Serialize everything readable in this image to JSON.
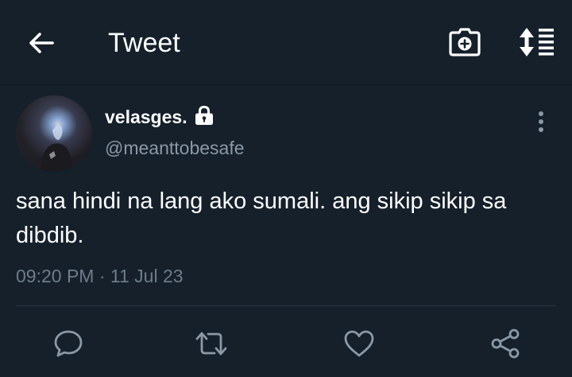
{
  "header": {
    "title": "Tweet",
    "icons": {
      "back": "back-arrow-icon",
      "camera": "camera-icon",
      "sort": "sort-icon"
    }
  },
  "tweet": {
    "display_name": "velasges.",
    "handle": "@meanttobesafe",
    "protected_icon": "lock-icon",
    "text": "sana hindi na lang ako sumali. ang sikip sikip sa dibdib.",
    "time": "09:20 PM",
    "separator": "·",
    "date": "11 Jul 23",
    "actions": [
      "reply-icon",
      "retweet-icon",
      "heart-icon",
      "share-icon"
    ]
  },
  "colors": {
    "background": "#15202b",
    "text_primary": "#ffffff",
    "text_secondary": "#8b98a5",
    "icon_muted": "#8b98a5",
    "divider": "#2a3642"
  }
}
